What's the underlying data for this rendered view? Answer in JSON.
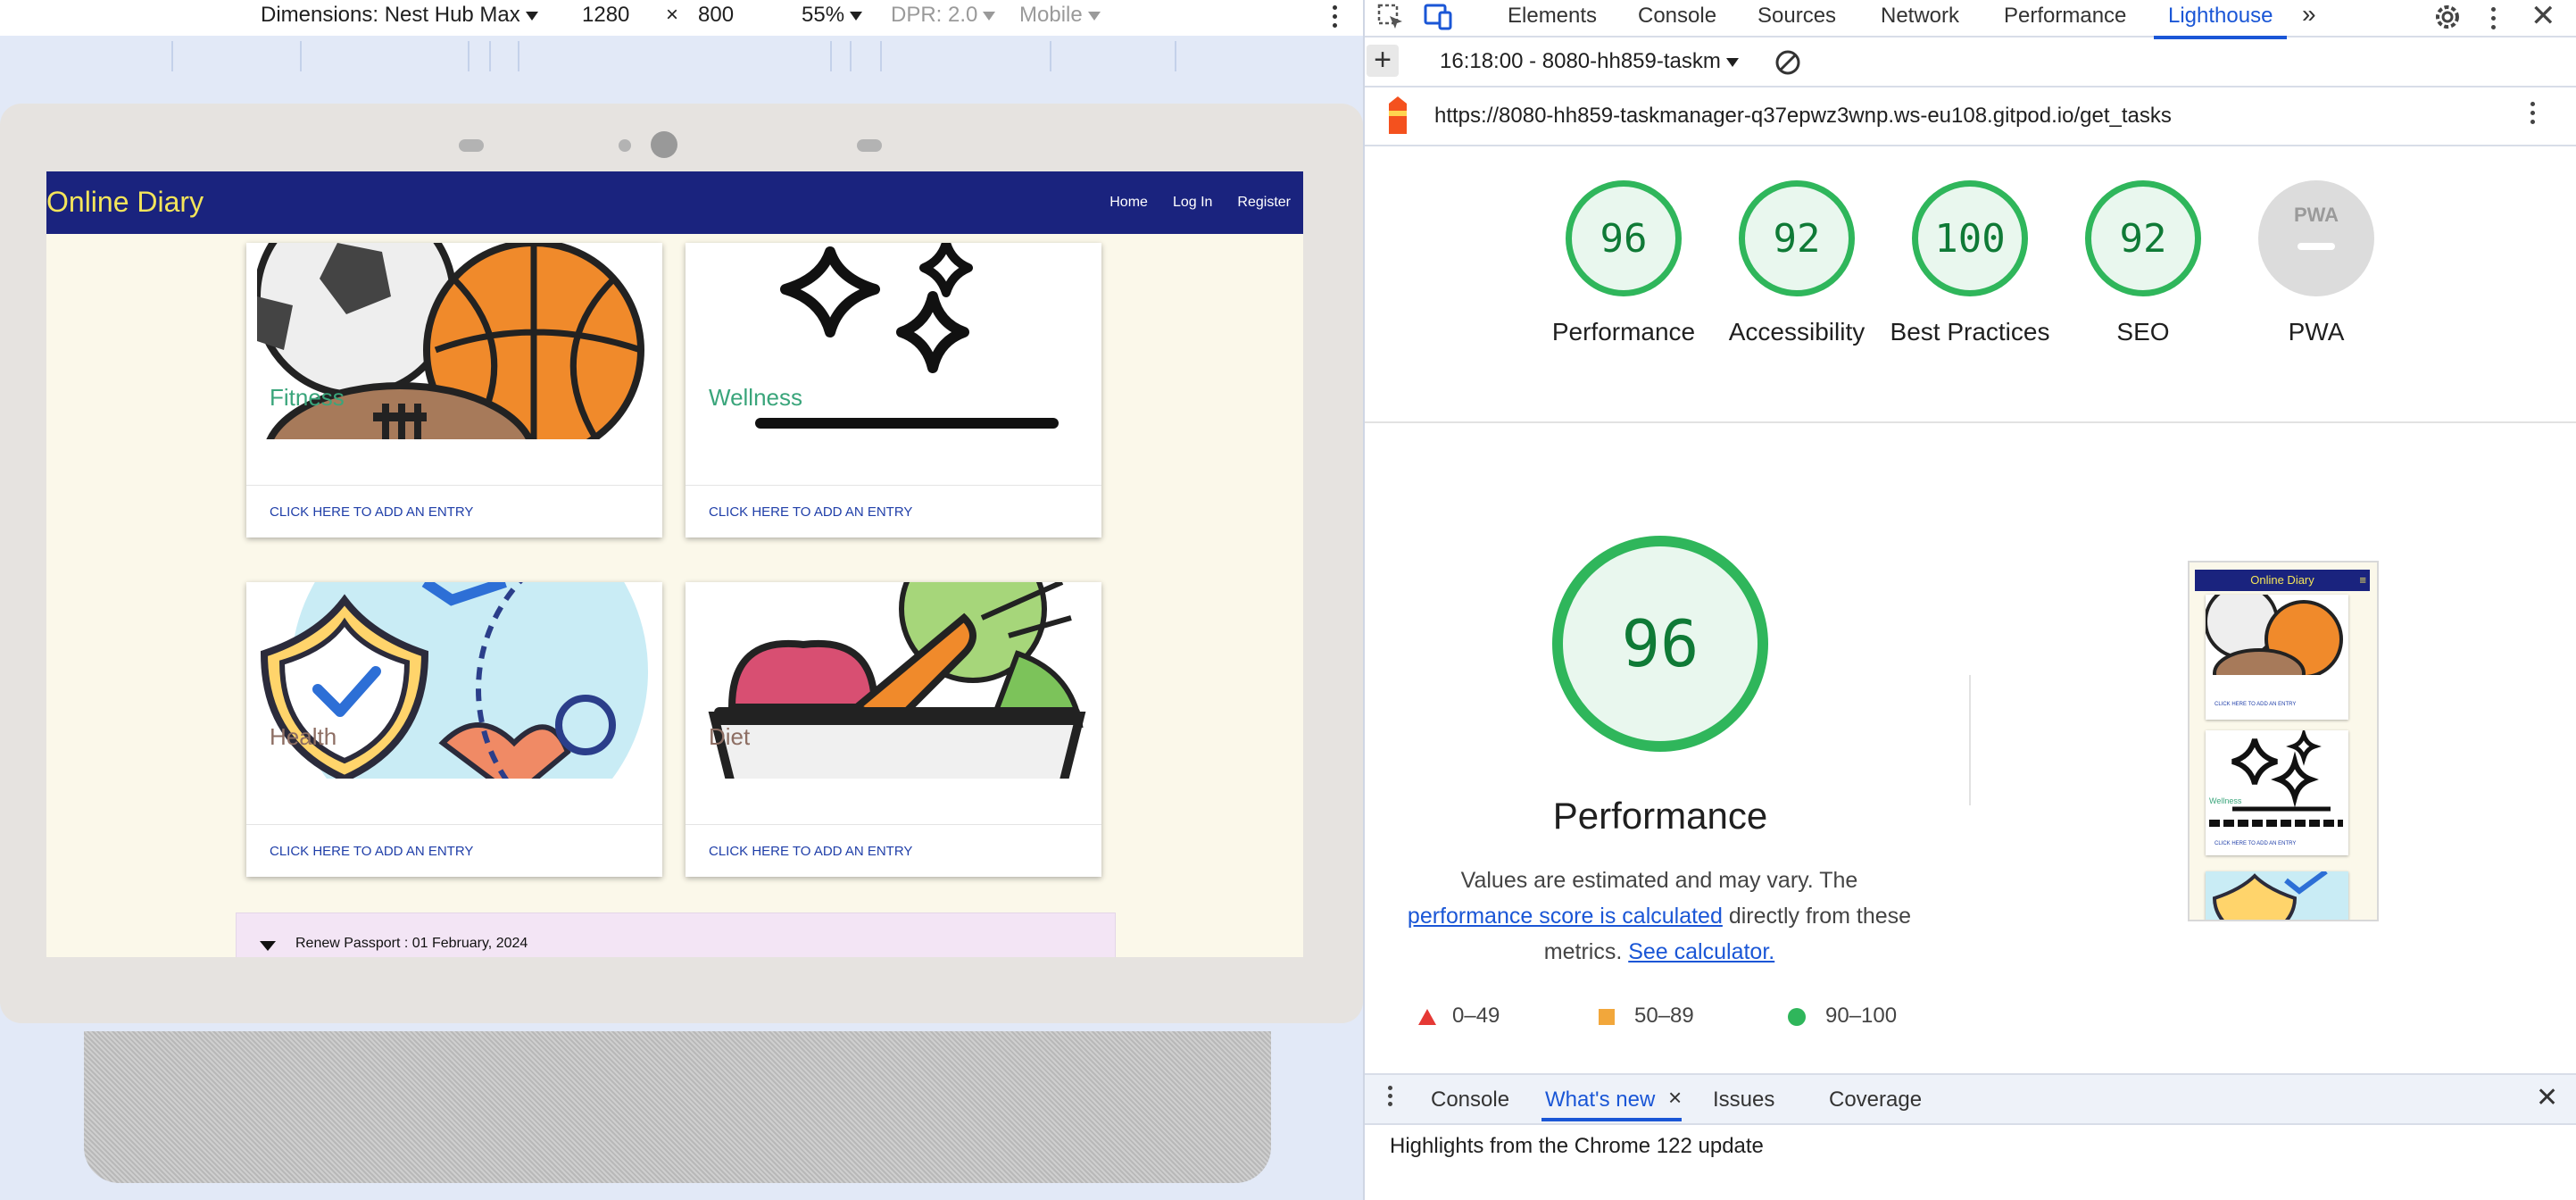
{
  "toolbar": {
    "dimensions_label": "Dimensions: Nest Hub Max",
    "width": "1280",
    "times": "×",
    "height": "800",
    "zoom": "55%",
    "dpr": "DPR: 2.0",
    "throttle": "Mobile"
  },
  "diary_app": {
    "brand": "Online Diary",
    "nav": [
      "Home",
      "Log In",
      "Register"
    ],
    "cards": [
      {
        "title": "Fitness",
        "cta": "CLICK HERE TO ADD AN ENTRY",
        "title_color": "#3aa57b"
      },
      {
        "title": "Wellness",
        "cta": "CLICK HERE TO ADD AN ENTRY",
        "title_color": "#3aa57b"
      },
      {
        "title": "Health",
        "cta": "CLICK HERE TO ADD AN ENTRY",
        "title_color": "#8d6e63"
      },
      {
        "title": "Diet",
        "cta": "CLICK HERE TO ADD AN ENTRY",
        "title_color": "#8d6e63"
      }
    ],
    "task": "Renew Passport : 01 February, 2024",
    "colors": {
      "nav_bg": "#1a237e",
      "brand": "#f4e55a",
      "page_bg": "#fbf8ea",
      "cta": "#1f3ea8"
    }
  },
  "devtools": {
    "tabs": [
      "Elements",
      "Console",
      "Sources",
      "Network",
      "Performance",
      "Lighthouse"
    ],
    "active_tab": "Lighthouse",
    "report_select": "16:18:00 - 8080-hh859-taskm",
    "url": "https://8080-hh859-taskmanager-q37epwz3wnp.ws-eu108.gitpod.io/get_tasks",
    "scores": [
      {
        "label": "Performance",
        "value": "96"
      },
      {
        "label": "Accessibility",
        "value": "92"
      },
      {
        "label": "Best Practices",
        "value": "100"
      },
      {
        "label": "SEO",
        "value": "92"
      },
      {
        "label": "PWA",
        "value": ""
      }
    ],
    "pwa_badge": "PWA",
    "performance": {
      "score": "96",
      "title": "Performance",
      "note_prefix": "Values are estimated and may vary. The ",
      "note_link1": "performance score is calculated",
      "note_mid": " directly from these metrics. ",
      "note_link2": "See calculator.",
      "legend": [
        "0–49",
        "50–89",
        "90–100"
      ],
      "colors": {
        "fail": "#e53935",
        "average": "#f2a73b",
        "pass": "#2fb65b"
      }
    },
    "thumbnail": {
      "brand": "Online Diary",
      "card_title": "Wellness",
      "cta": "CLICK HERE TO ADD AN ENTRY"
    },
    "drawer_tabs": [
      "Console",
      "What's new",
      "Issues",
      "Coverage"
    ],
    "drawer_active": "What's new",
    "highlights": "Highlights from the Chrome 122 update"
  }
}
